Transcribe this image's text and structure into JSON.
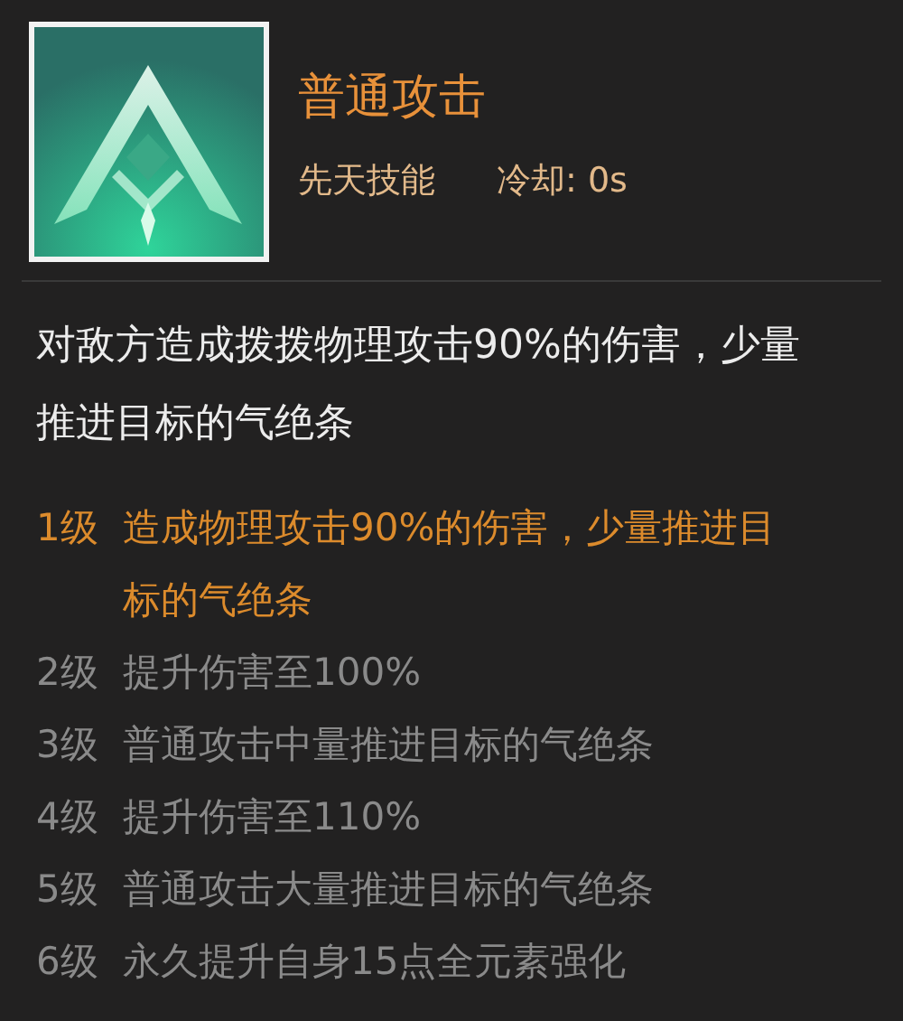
{
  "skill": {
    "name": "普通攻击",
    "type": "先天技能",
    "cooldown": "冷却: 0s"
  },
  "description": "对敌方造成拨拨物理攻击90%的伤害，少量推进目标的气绝条",
  "levels": [
    {
      "label": "1级",
      "text": "造成物理攻击90%的伤害，少量推进目标的气绝条",
      "unlocked": true
    },
    {
      "label": "2级",
      "text": "提升伤害至100%",
      "unlocked": false
    },
    {
      "label": "3级",
      "text": "普通攻击中量推进目标的气绝条",
      "unlocked": false
    },
    {
      "label": "4级",
      "text": "提升伤害至110%",
      "unlocked": false
    },
    {
      "label": "5级",
      "text": "普通攻击大量推进目标的气绝条",
      "unlocked": false
    },
    {
      "label": "6级",
      "text": "永久提升自身15点全元素强化",
      "unlocked": false
    }
  ]
}
